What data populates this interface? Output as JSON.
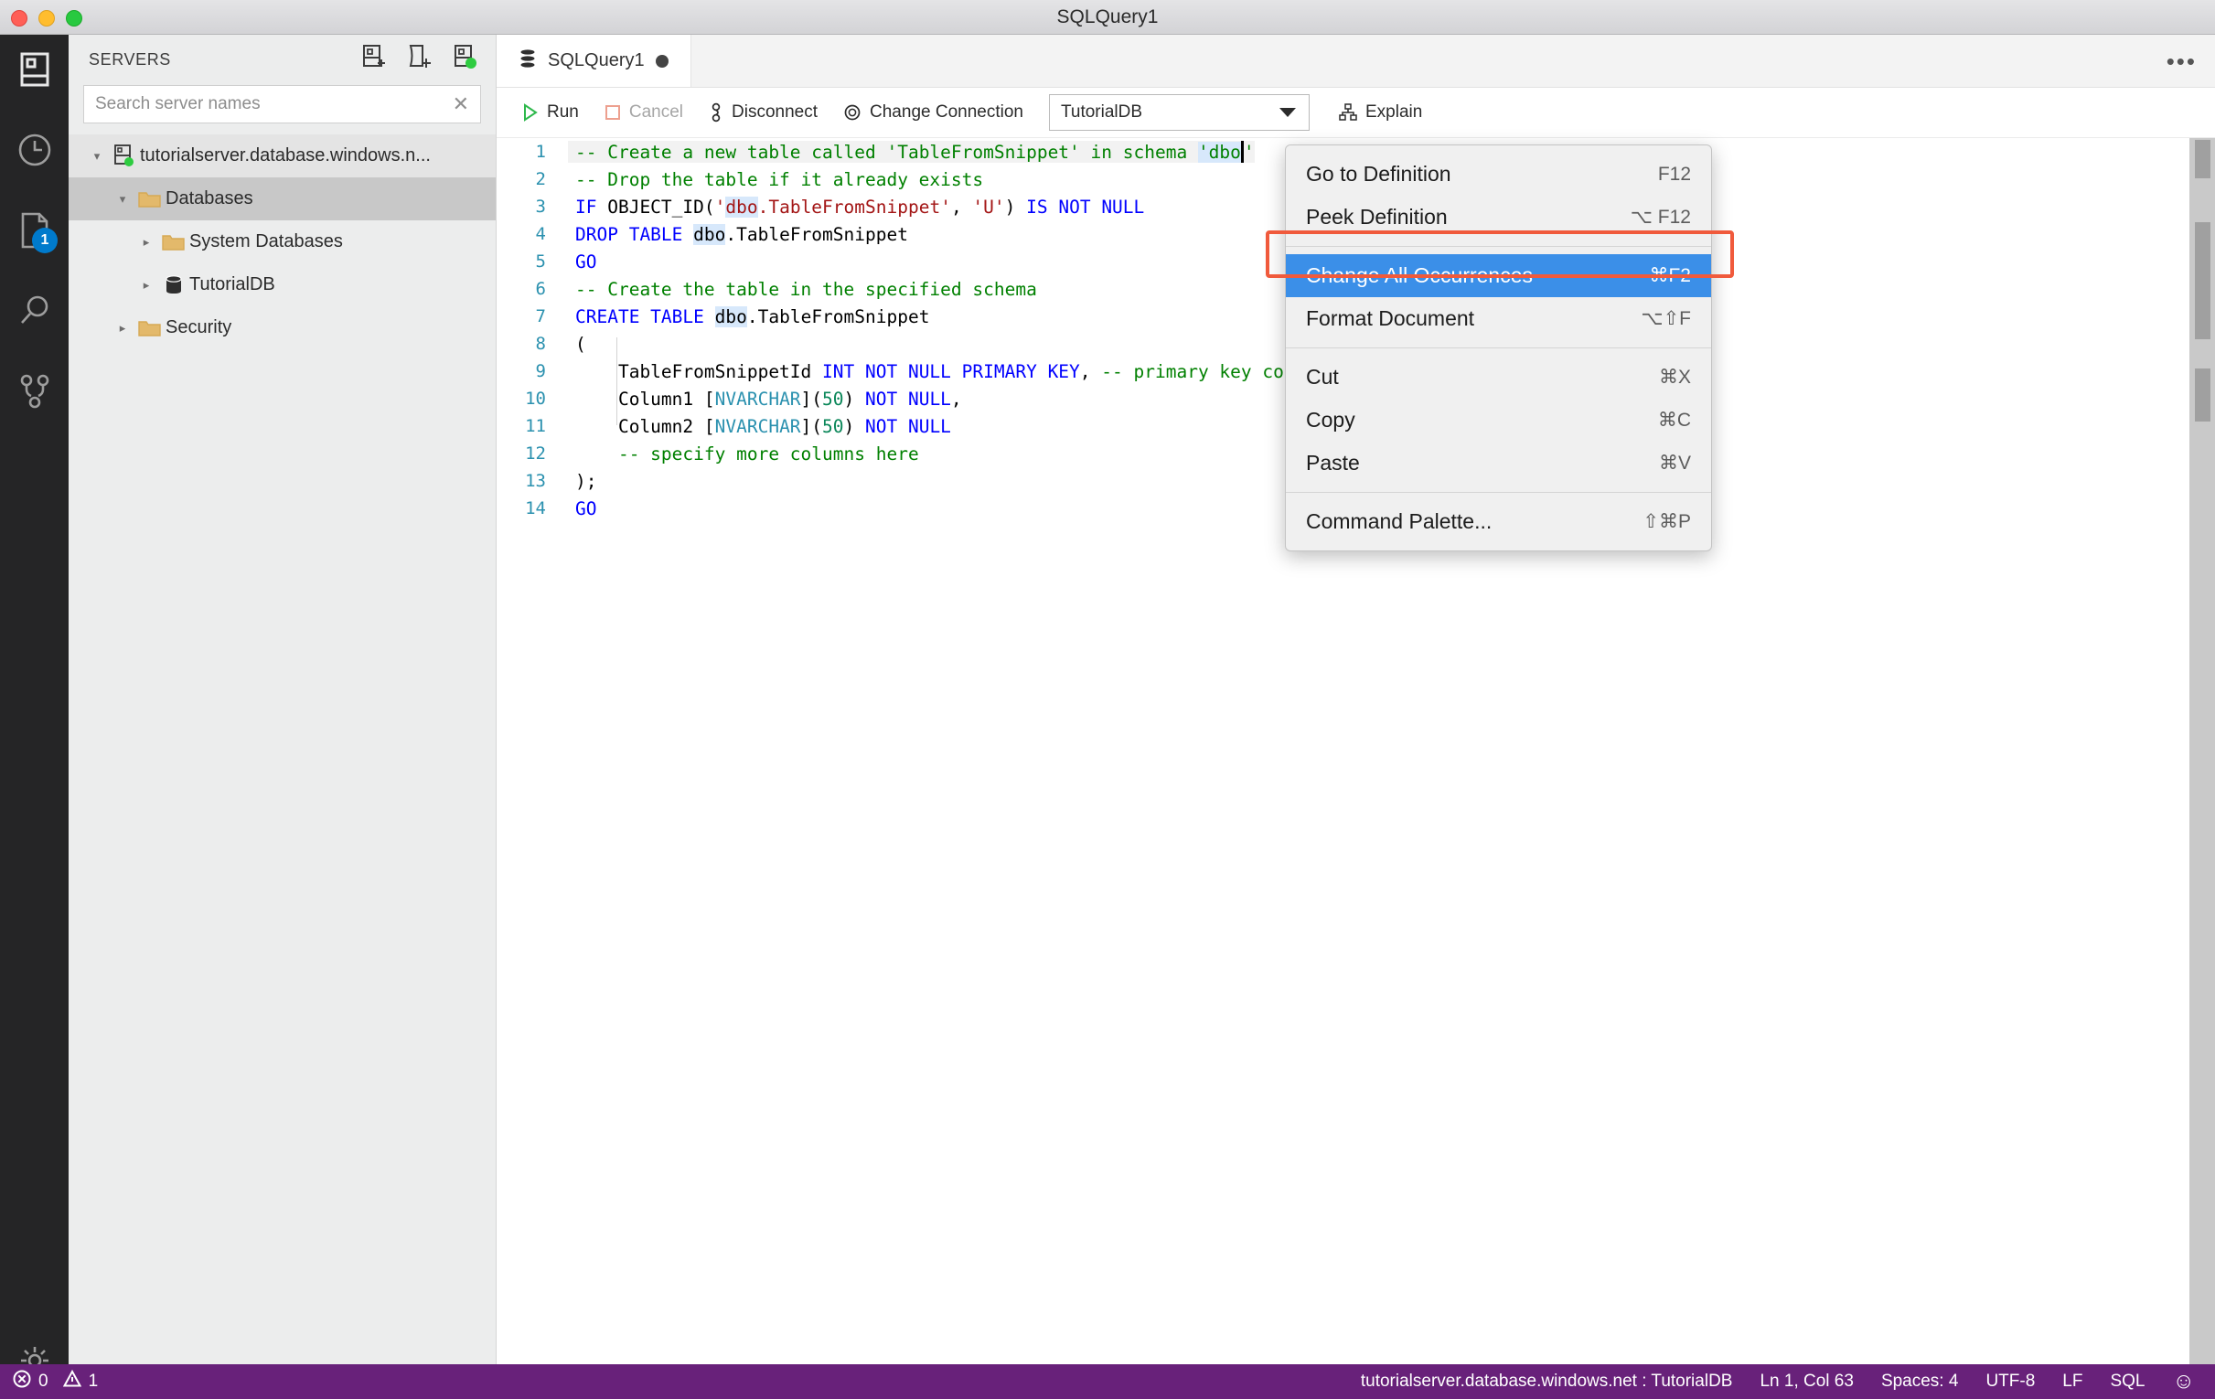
{
  "window": {
    "title": "SQLQuery1",
    "traffic_lights": [
      "close",
      "minimize",
      "zoom"
    ]
  },
  "activity_bar": {
    "items": [
      {
        "name": "servers-icon",
        "tooltip": "Servers"
      },
      {
        "name": "history-icon",
        "tooltip": "Query History"
      },
      {
        "name": "open-editors-icon",
        "tooltip": "Open Editors",
        "badge": "1"
      },
      {
        "name": "search-icon",
        "tooltip": "Search"
      },
      {
        "name": "source-control-icon",
        "tooltip": "Source Control"
      },
      {
        "name": "gear-icon",
        "tooltip": "Manage"
      }
    ],
    "badge_color": "#007acc"
  },
  "sidebar": {
    "title": "SERVERS",
    "actions": [
      {
        "name": "new-connection-icon",
        "label": "New Connection"
      },
      {
        "name": "new-query-icon",
        "label": "New Query"
      },
      {
        "name": "new-server-group-icon",
        "label": "New Server Group"
      }
    ],
    "search": {
      "placeholder": "Search server names",
      "value": "",
      "clear_glyph": "✕"
    },
    "tree": [
      {
        "label": "tutorialserver.database.windows.n...",
        "icon": "server-connected-icon",
        "indent": 0,
        "expanded": true,
        "state": "hover"
      },
      {
        "label": "Databases",
        "icon": "folder-icon",
        "indent": 1,
        "expanded": true,
        "state": "selected"
      },
      {
        "label": "System Databases",
        "icon": "folder-icon",
        "indent": 2,
        "expanded": false,
        "state": "normal"
      },
      {
        "label": "TutorialDB",
        "icon": "database-icon",
        "indent": 2,
        "expanded": false,
        "state": "normal"
      },
      {
        "label": "Security",
        "icon": "folder-icon",
        "indent": 1,
        "expanded": false,
        "state": "normal"
      }
    ]
  },
  "tabs": [
    {
      "label": "SQLQuery1",
      "icon": "database-icon",
      "dirty": true,
      "active": true
    }
  ],
  "tab_overflow_glyph": "•••",
  "query_toolbar": {
    "run_label": "Run",
    "cancel_label": "Cancel",
    "disconnect_label": "Disconnect",
    "change_connection_label": "Change Connection",
    "database_select": "TutorialDB",
    "explain_label": "Explain"
  },
  "editor": {
    "language": "SQL",
    "lines": [
      {
        "n": "1",
        "current": true,
        "tokens": [
          {
            "t": "-- Create a new table called ",
            "cls": "c"
          },
          {
            "t": "'TableFromSnippet'",
            "cls": "c"
          },
          {
            "t": " in schema ",
            "cls": "c"
          },
          {
            "t": "'dbo",
            "cls": "c hl"
          },
          {
            "t": "CARET",
            "cls": "caret"
          },
          {
            "t": "'",
            "cls": "c"
          }
        ]
      },
      {
        "n": "2",
        "current": false,
        "tokens": [
          {
            "t": "-- Drop the table if it already exists",
            "cls": "c"
          }
        ]
      },
      {
        "n": "3",
        "current": false,
        "tokens": [
          {
            "t": "IF",
            "cls": "k"
          },
          {
            "t": " OBJECT_ID(",
            "cls": ""
          },
          {
            "t": "'",
            "cls": "s"
          },
          {
            "t": "dbo",
            "cls": "s hl"
          },
          {
            "t": ".TableFromSnippet'",
            "cls": "s"
          },
          {
            "t": ", ",
            "cls": ""
          },
          {
            "t": "'U'",
            "cls": "s"
          },
          {
            "t": ") ",
            "cls": ""
          },
          {
            "t": "IS NOT NULL",
            "cls": "k"
          }
        ]
      },
      {
        "n": "4",
        "current": false,
        "tokens": [
          {
            "t": "DROP TABLE",
            "cls": "k"
          },
          {
            "t": " ",
            "cls": ""
          },
          {
            "t": "dbo",
            "cls": "hl"
          },
          {
            "t": ".TableFromSnippet",
            "cls": ""
          }
        ]
      },
      {
        "n": "5",
        "current": false,
        "tokens": [
          {
            "t": "GO",
            "cls": "k"
          }
        ]
      },
      {
        "n": "6",
        "current": false,
        "tokens": [
          {
            "t": "-- Create the table in the specified schema",
            "cls": "c"
          }
        ]
      },
      {
        "n": "7",
        "current": false,
        "tokens": [
          {
            "t": "CREATE TABLE",
            "cls": "k"
          },
          {
            "t": " ",
            "cls": ""
          },
          {
            "t": "dbo",
            "cls": "hl"
          },
          {
            "t": ".TableFromSnippet",
            "cls": ""
          }
        ]
      },
      {
        "n": "8",
        "current": false,
        "tokens": [
          {
            "t": "(",
            "cls": ""
          }
        ]
      },
      {
        "n": "9",
        "current": false,
        "tokens": [
          {
            "t": "    TableFromSnippetId ",
            "cls": ""
          },
          {
            "t": "INT NOT NULL PRIMARY KEY",
            "cls": "k"
          },
          {
            "t": ", ",
            "cls": ""
          },
          {
            "t": "-- primary key column",
            "cls": "c"
          }
        ]
      },
      {
        "n": "10",
        "current": false,
        "tokens": [
          {
            "t": "    Column1 [",
            "cls": ""
          },
          {
            "t": "NVARCHAR",
            "cls": "t"
          },
          {
            "t": "](",
            "cls": ""
          },
          {
            "t": "50",
            "cls": "n"
          },
          {
            "t": ") ",
            "cls": ""
          },
          {
            "t": "NOT NULL",
            "cls": "k"
          },
          {
            "t": ",",
            "cls": ""
          }
        ]
      },
      {
        "n": "11",
        "current": false,
        "tokens": [
          {
            "t": "    Column2 [",
            "cls": ""
          },
          {
            "t": "NVARCHAR",
            "cls": "t"
          },
          {
            "t": "](",
            "cls": ""
          },
          {
            "t": "50",
            "cls": "n"
          },
          {
            "t": ") ",
            "cls": ""
          },
          {
            "t": "NOT NULL",
            "cls": "k"
          }
        ]
      },
      {
        "n": "12",
        "current": false,
        "tokens": [
          {
            "t": "    -- specify more columns here",
            "cls": "c"
          }
        ]
      },
      {
        "n": "13",
        "current": false,
        "tokens": [
          {
            "t": ");",
            "cls": ""
          }
        ]
      },
      {
        "n": "14",
        "current": false,
        "tokens": [
          {
            "t": "GO",
            "cls": "k"
          }
        ]
      }
    ]
  },
  "context_menu": {
    "highlight_color": "#f05a3c",
    "active_color": "#3b8fe8",
    "groups": [
      [
        {
          "label": "Go to Definition",
          "shortcut": "F12",
          "active": false
        },
        {
          "label": "Peek Definition",
          "shortcut": "⌥ F12",
          "active": false
        }
      ],
      [
        {
          "label": "Change All Occurrences",
          "shortcut": "⌘F2",
          "active": true
        },
        {
          "label": "Format Document",
          "shortcut": "⌥⇧F",
          "active": false
        }
      ],
      [
        {
          "label": "Cut",
          "shortcut": "⌘X",
          "active": false
        },
        {
          "label": "Copy",
          "shortcut": "⌘C",
          "active": false
        },
        {
          "label": "Paste",
          "shortcut": "⌘V",
          "active": false
        }
      ],
      [
        {
          "label": "Command Palette...",
          "shortcut": "⇧⌘P",
          "active": false
        }
      ]
    ]
  },
  "status_bar": {
    "background": "#68217a",
    "errors": "0",
    "warnings": "1",
    "connection": "tutorialserver.database.windows.net : TutorialDB",
    "cursor_position": "Ln 1, Col 63",
    "indentation": "Spaces: 4",
    "encoding": "UTF-8",
    "eol": "LF",
    "language": "SQL",
    "feedback_glyph": "☺"
  }
}
